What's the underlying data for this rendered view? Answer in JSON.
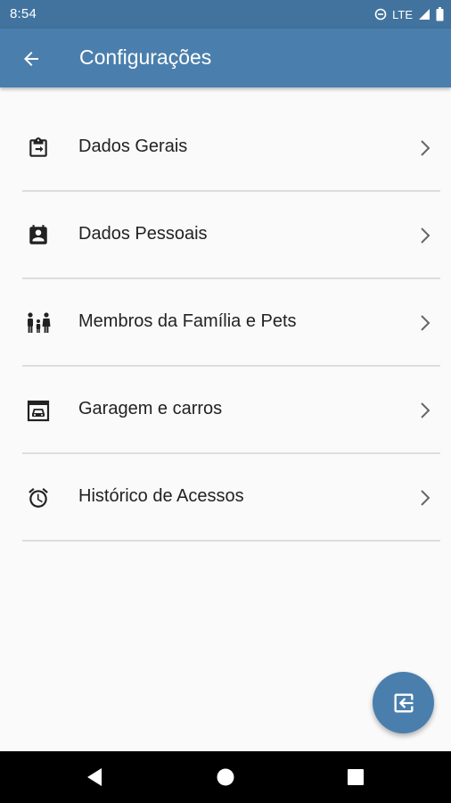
{
  "status_bar": {
    "time": "8:54",
    "network": "LTE",
    "icons": [
      "do-not-disturb-icon",
      "signal-icon",
      "battery-icon"
    ]
  },
  "app_bar": {
    "title": "Configurações",
    "back_icon": "arrow-back-icon",
    "background": "#4a7fad"
  },
  "menu": {
    "items": [
      {
        "label": "Dados Gerais",
        "icon": "clipboard-arrow-icon"
      },
      {
        "label": "Dados Pessoais",
        "icon": "contact-card-icon"
      },
      {
        "label": "Membros da Família e Pets",
        "icon": "family-icon"
      },
      {
        "label": "Garagem e carros",
        "icon": "garage-car-icon"
      },
      {
        "label": "Histórico de Acessos",
        "icon": "alarm-clock-icon"
      }
    ],
    "chevron_icon": "chevron-right-icon"
  },
  "fab": {
    "icon": "logout-icon",
    "color": "#4a7fad"
  },
  "nav_bar": {
    "buttons": [
      "back-triangle-icon",
      "home-circle-icon",
      "recents-square-icon"
    ]
  }
}
